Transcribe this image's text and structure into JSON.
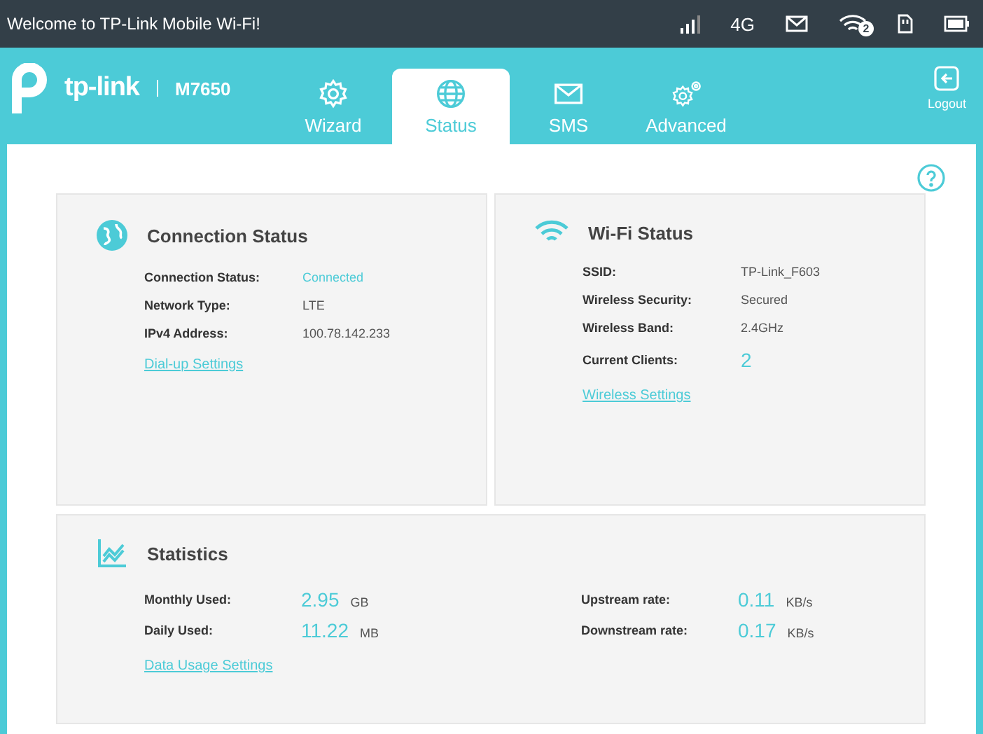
{
  "status_bar": {
    "welcome": "Welcome to TP-Link Mobile Wi-Fi!",
    "network": "4G",
    "wifi_clients": "2"
  },
  "header": {
    "brand": "tp-link",
    "model": "M7650",
    "logout": "Logout"
  },
  "tabs": [
    {
      "label": "Wizard",
      "selected": false
    },
    {
      "label": "Status",
      "selected": true
    },
    {
      "label": "SMS",
      "selected": false
    },
    {
      "label": "Advanced",
      "selected": false
    }
  ],
  "connection": {
    "title": "Connection Status",
    "rows": [
      {
        "label": "Connection Status:",
        "value": "Connected",
        "kind": "status"
      },
      {
        "label": "Network Type:",
        "value": "LTE",
        "kind": "text"
      },
      {
        "label": "IPv4 Address:",
        "value": "100.78.142.233",
        "kind": "text"
      }
    ],
    "link": "Dial-up Settings"
  },
  "wifi": {
    "title": "Wi-Fi Status",
    "rows": [
      {
        "label": "SSID:",
        "value": "TP-Link_F603",
        "kind": "text"
      },
      {
        "label": "Wireless Security:",
        "value": "Secured",
        "kind": "text"
      },
      {
        "label": "Wireless Band:",
        "value": "2.4GHz",
        "kind": "text"
      },
      {
        "label": "Current Clients:",
        "value": "2",
        "kind": "count"
      }
    ],
    "link": "Wireless Settings"
  },
  "statistics": {
    "title": "Statistics",
    "items": [
      {
        "label": "Monthly Used:",
        "value": "2.95",
        "unit": "GB"
      },
      {
        "label": "Upstream rate:",
        "value": "0.11",
        "unit": "KB/s"
      },
      {
        "label": "Daily Used:",
        "value": "11.22",
        "unit": "MB"
      },
      {
        "label": "Downstream rate:",
        "value": "0.17",
        "unit": "KB/s"
      }
    ],
    "link": "Data Usage Settings"
  }
}
